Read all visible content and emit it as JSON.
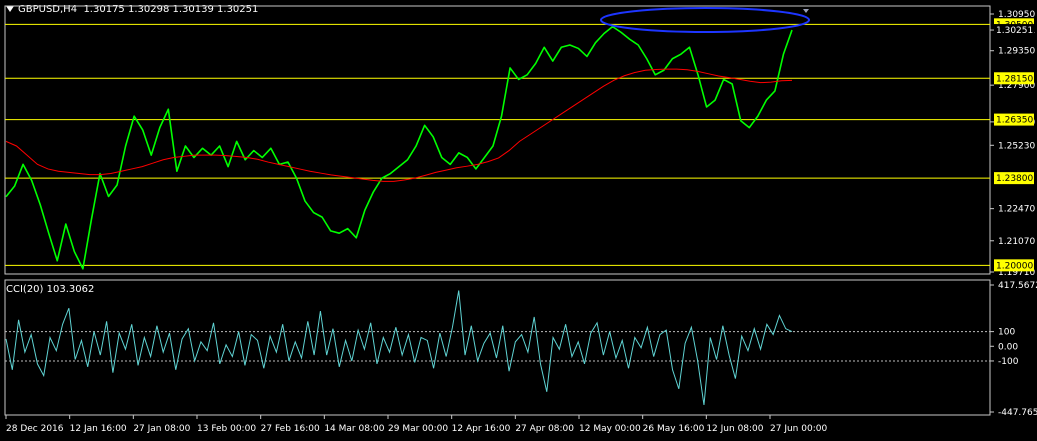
{
  "header": {
    "symbol": "GBPUSD,H4",
    "ohlc": "1.30175 1.30298 1.30139 1.30251"
  },
  "indicator": {
    "label": "CCI(20) 103.3062"
  },
  "colors": {
    "background": "#000000",
    "price": "#00ff00",
    "ma": "#ff0000",
    "cci": "#5fd3d3",
    "hline": "#ffff00",
    "highlight_ellipse": "#1d35ff",
    "label_bg": "#ffff00"
  },
  "chart_data": [
    {
      "type": "line",
      "title": "GBPUSD,H4",
      "xlabel": "",
      "ylabel": "",
      "ylim": [
        1.1971,
        1.3095
      ],
      "x_ticks": [
        "28 Dec 2016",
        "12 Jan 16:00",
        "27 Jan 08:00",
        "13 Feb 00:00",
        "27 Feb 16:00",
        "14 Mar 08:00",
        "29 Mar 00:00",
        "12 Apr 16:00",
        "27 Apr 08:00",
        "12 May 00:00",
        "26 May 16:00",
        "12 Jun 08:00",
        "27 Jun 00:00"
      ],
      "y_ticks": [
        1.3095,
        1.30251,
        1.2935,
        1.2785,
        1.2625,
        1.2523,
        1.2247,
        1.2107,
        1.1971
      ],
      "y_tick_labels": [
        "1.30950",
        "1.30251",
        "1.29350",
        "1.27900",
        "1.26500",
        "1.25230",
        "1.22470",
        "1.21070",
        "1.19710"
      ],
      "levels": [
        {
          "value": 1.305,
          "label": "1.30500"
        },
        {
          "value": 1.2815,
          "label": "1.28150"
        },
        {
          "value": 1.2635,
          "label": "1.26350"
        },
        {
          "value": 1.238,
          "label": "1.23800"
        },
        {
          "value": 1.2,
          "label": "1.20000"
        }
      ],
      "current_price": {
        "value": 1.30251,
        "label": "1.30251"
      },
      "series": [
        {
          "kind": "price",
          "values": [
            1.2299,
            1.2345,
            1.244,
            1.237,
            1.2265,
            1.214,
            1.202,
            1.218,
            1.206,
            1.1985,
            1.22,
            1.24,
            1.23,
            1.235,
            1.252,
            1.265,
            1.259,
            1.248,
            1.26,
            1.268,
            1.241,
            1.252,
            1.247,
            1.251,
            1.248,
            1.252,
            1.243,
            1.254,
            1.246,
            1.25,
            1.247,
            1.251,
            1.244,
            1.245,
            1.238,
            1.228,
            1.223,
            1.221,
            1.215,
            1.214,
            1.216,
            1.212,
            1.224,
            1.232,
            1.238,
            1.24,
            1.243,
            1.246,
            1.252,
            1.261,
            1.256,
            1.247,
            1.244,
            1.249,
            1.247,
            1.242,
            1.247,
            1.252,
            1.265,
            1.286,
            1.281,
            1.283,
            1.288,
            1.295,
            1.289,
            1.295,
            1.296,
            1.2945,
            1.291,
            1.297,
            1.301,
            1.304,
            1.3015,
            1.2985,
            1.296,
            1.29,
            1.283,
            1.285,
            1.29,
            1.292,
            1.295,
            1.283,
            1.269,
            1.272,
            1.281,
            1.279,
            1.263,
            1.26,
            1.265,
            1.272,
            1.276,
            1.292,
            1.3025
          ]
        },
        {
          "kind": "ma",
          "values": [
            1.254,
            1.252,
            1.248,
            1.244,
            1.242,
            1.241,
            1.2405,
            1.24,
            1.2395,
            1.2395,
            1.24,
            1.241,
            1.242,
            1.243,
            1.2445,
            1.246,
            1.247,
            1.2475,
            1.248,
            1.248,
            1.248,
            1.2478,
            1.2474,
            1.247,
            1.2462,
            1.245,
            1.244,
            1.243,
            1.242,
            1.241,
            1.2402,
            1.2394,
            1.2388,
            1.2382,
            1.2376,
            1.237,
            1.2366,
            1.2366,
            1.2372,
            1.238,
            1.2392,
            1.2405,
            1.2415,
            1.2425,
            1.2432,
            1.244,
            1.2452,
            1.2468,
            1.25,
            1.254,
            1.257,
            1.26,
            1.263,
            1.266,
            1.269,
            1.272,
            1.275,
            1.278,
            1.2806,
            1.2826,
            1.284,
            1.285,
            1.2853,
            1.2855,
            1.2855,
            1.2852,
            1.2845,
            1.2835,
            1.2825,
            1.2818,
            1.281,
            1.2802,
            1.2796,
            1.2798,
            1.2804,
            1.2806
          ]
        }
      ]
    },
    {
      "type": "line",
      "title": "CCI(20) 103.3062",
      "ylim": [
        -447.7658,
        417.5672
      ],
      "y_ticks": [
        417.5672,
        100,
        0,
        -100,
        -447.7658
      ],
      "y_tick_labels": [
        "417.5672",
        "100",
        "0.00",
        "-100",
        "-447.7658"
      ],
      "dashed_levels": [
        100,
        -100
      ],
      "series": [
        {
          "kind": "cci",
          "values": [
            50,
            -160,
            180,
            -40,
            80,
            -120,
            -200,
            60,
            -30,
            150,
            260,
            -90,
            40,
            -140,
            100,
            -60,
            170,
            -180,
            90,
            -20,
            150,
            -130,
            60,
            -70,
            140,
            -40,
            90,
            -160,
            50,
            120,
            -100,
            30,
            -30,
            160,
            -120,
            10,
            -70,
            100,
            -130,
            80,
            40,
            -150,
            70,
            -40,
            150,
            -100,
            30,
            -80,
            170,
            -60,
            240,
            -60,
            120,
            -140,
            40,
            -100,
            110,
            -20,
            160,
            -120,
            60,
            -40,
            130,
            -60,
            80,
            -110,
            60,
            40,
            -150,
            90,
            -70,
            130,
            380,
            -60,
            140,
            -100,
            20,
            90,
            -80,
            140,
            -170,
            30,
            80,
            -40,
            200,
            -120,
            -310,
            60,
            -20,
            150,
            -70,
            30,
            -120,
            90,
            160,
            -60,
            100,
            -80,
            40,
            -150,
            60,
            -10,
            130,
            -70,
            80,
            110,
            -160,
            -290,
            20,
            130,
            -100,
            -400,
            60,
            -90,
            140,
            -60,
            -220,
            70,
            -30,
            120,
            -20,
            150,
            80,
            210,
            120,
            100
          ]
        }
      ]
    }
  ]
}
